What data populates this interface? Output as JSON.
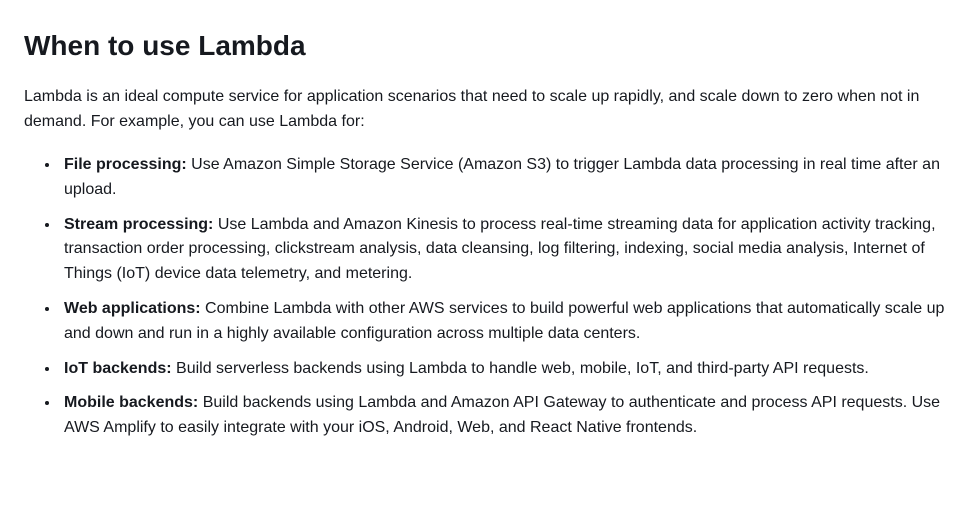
{
  "heading": "When to use Lambda",
  "intro": "Lambda is an ideal compute service for application scenarios that need to scale up rapidly, and scale down to zero when not in demand. For example, you can use Lambda for:",
  "items": [
    {
      "term": "File processing:",
      "desc": " Use Amazon Simple Storage Service (Amazon S3) to trigger Lambda data processing in real time after an upload."
    },
    {
      "term": "Stream processing:",
      "desc": " Use Lambda and Amazon Kinesis to process real-time streaming data for application activity tracking, transaction order processing, clickstream analysis, data cleansing, log filtering, indexing, social media analysis, Internet of Things (IoT) device data telemetry, and metering."
    },
    {
      "term": "Web applications:",
      "desc": " Combine Lambda with other AWS services to build powerful web applications that automatically scale up and down and run in a highly available configuration across multiple data centers."
    },
    {
      "term": "IoT backends:",
      "desc": " Build serverless backends using Lambda to handle web, mobile, IoT, and third-party API requests."
    },
    {
      "term": "Mobile backends:",
      "desc": " Build backends using Lambda and Amazon API Gateway to authenticate and process API requests. Use AWS Amplify to easily integrate with your iOS, Android, Web, and React Native frontends."
    }
  ]
}
